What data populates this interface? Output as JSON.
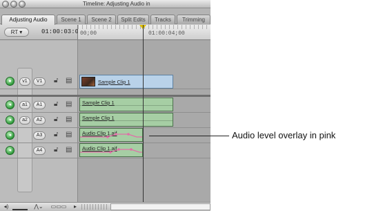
{
  "window": {
    "title": "Timeline: Adjusting Audio in"
  },
  "tabs": [
    {
      "label": "Adjusting Audio",
      "active": true
    },
    {
      "label": "Scene 1"
    },
    {
      "label": "Scene 2"
    },
    {
      "label": "Split Edits"
    },
    {
      "label": "Tracks"
    },
    {
      "label": "Trimming"
    }
  ],
  "header": {
    "rt_label": "RT",
    "timecode": "01:00:03:01",
    "ruler_start": "00;00",
    "ruler_mark": "01:00:04;00"
  },
  "tracks": [
    {
      "source": "v1",
      "dest": "V1",
      "kind": "video",
      "clip": "Sample Clip 1"
    },
    {
      "source": "a1",
      "dest": "A1",
      "kind": "audio",
      "clip": "Sample Clip 1"
    },
    {
      "source": "a2",
      "dest": "A2",
      "kind": "audio",
      "clip": "Sample Clip 1"
    },
    {
      "source": "",
      "dest": "A3",
      "kind": "audio",
      "clip": "Audio Clip 1.aif"
    },
    {
      "source": "",
      "dest": "A4",
      "kind": "audio",
      "clip": "Audio Clip 1.aif"
    }
  ],
  "callout": {
    "text": "Audio level overlay in pink"
  },
  "colors": {
    "audio_clip": "#a6cea4",
    "video_clip": "#b9d2e9",
    "level_overlay": "#e06ea8",
    "track_visibility": "#2f9a3a",
    "playhead_cap": "#e0c000"
  }
}
